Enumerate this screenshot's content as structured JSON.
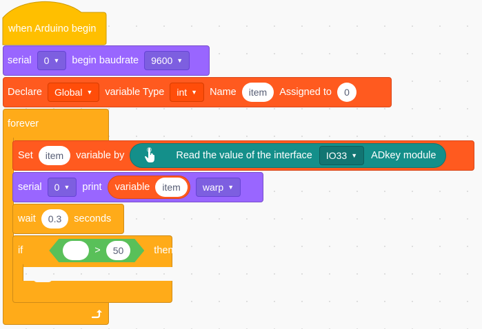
{
  "hat": {
    "label": "when Arduino begin"
  },
  "serial_begin": {
    "serial_label": "serial",
    "port": "0",
    "begin_label": "begin baudrate",
    "baudrate": "9600"
  },
  "declare": {
    "declare_label": "Declare",
    "scope": "Global",
    "type_label": "variable Type",
    "type": "int",
    "name_label": "Name",
    "name": "item",
    "assigned_label": "Assigned to",
    "value": "0"
  },
  "forever": {
    "label": "forever",
    "loop_icon": "loop-arrow-icon"
  },
  "set_block": {
    "set_label": "Set",
    "var": "item",
    "by_label": "variable by",
    "reporter": {
      "icon": "touch-hand-icon",
      "read_label": "Read the value of the interface",
      "pin": "IO33",
      "module_label": "ADkey module"
    }
  },
  "print_block": {
    "serial_label": "serial",
    "port": "0",
    "print_label": "print",
    "var_reporter": {
      "label": "variable",
      "var": "item"
    },
    "mode": "warp"
  },
  "wait_block": {
    "wait_label": "wait",
    "value": "0.3",
    "seconds_label": "seconds"
  },
  "if_block": {
    "if_label": "if",
    "operator": ">",
    "right_value": "50",
    "then_label": "then"
  },
  "colors": {
    "events": "#ffbf00",
    "control": "#ffab19",
    "serial": "#9966ff",
    "variables": "#ff5a1f",
    "sensor": "#148f8a",
    "operator": "#59c059"
  }
}
